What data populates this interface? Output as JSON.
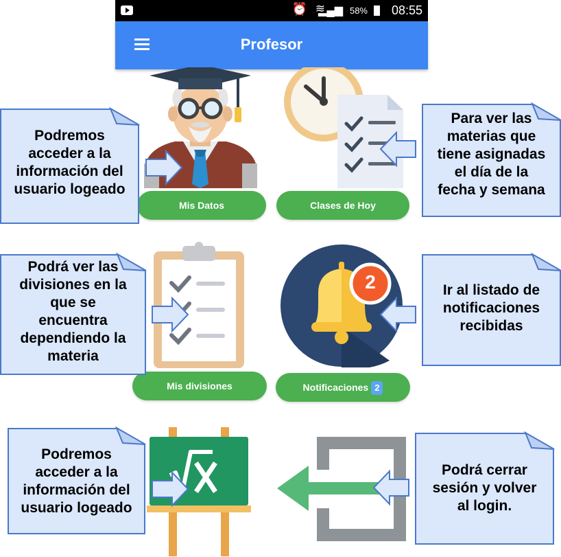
{
  "status_bar": {
    "battery": "58%",
    "time": "08:55"
  },
  "toolbar": {
    "title": "Profesor"
  },
  "buttons": {
    "mis_datos": "Mis Datos",
    "clases_hoy": "Clases de Hoy",
    "mis_divisiones": "Mis divisiones",
    "notificaciones": "Notificaciones",
    "notificaciones_count": "2"
  },
  "bell_badge": "2",
  "notes": {
    "datos": "Podremos\nacceder a la\ninformación del\nusuario logeado",
    "clases": "Para ver las\nmaterias que\ntiene asignadas\nel día de la\nfecha y semana",
    "divisiones": "Podrá ver las\ndivisiones en la\nque se\nencuentra\ndependiendo la\nmateria",
    "notificaciones": "Ir al listado de\nnotificaciones\nrecibidas",
    "pizarra": "Podremos\nacceder a la\ninformación del\nusuario logeado",
    "logout": "Podrá cerrar\nsesión y volver\nal login."
  },
  "icons": {
    "professor": "professor-icon",
    "clock": "clock-checklist-icon",
    "clipboard": "clipboard-icon",
    "bell": "bell-icon",
    "blackboard": "blackboard-sqrt-icon",
    "logout": "logout-icon"
  },
  "colors": {
    "toolbar": "#3e86f4",
    "button_green": "#4caf50",
    "note_fill": "#dbe7fb",
    "note_border": "#4a79c9"
  }
}
